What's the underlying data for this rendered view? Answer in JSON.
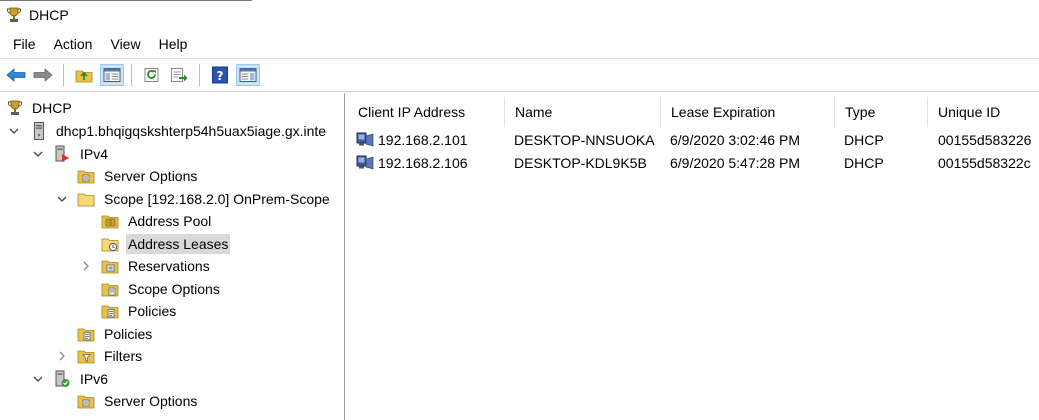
{
  "window": {
    "title": "DHCP"
  },
  "menu": [
    "File",
    "Action",
    "View",
    "Help"
  ],
  "toolbar": {
    "buttons": [
      "back-arrow-icon",
      "forward-arrow-icon",
      "up-folder-icon",
      "show-hide-console-tree-icon",
      "refresh-icon",
      "export-list-icon",
      "help-icon",
      "properties-icon"
    ]
  },
  "tree": {
    "root": "DHCP",
    "server": "dhcp1.bhqigqskshterp54h5uax5iage.gx.inte",
    "ipv4": "IPv4",
    "ipv4_server_options": "Server Options",
    "scope": "Scope [192.168.2.0] OnPrem-Scope",
    "address_pool": "Address Pool",
    "address_leases": "Address Leases",
    "reservations": "Reservations",
    "scope_options": "Scope Options",
    "scope_policies": "Policies",
    "ipv4_policies": "Policies",
    "filters": "Filters",
    "ipv6": "IPv6",
    "ipv6_server_options": "Server Options"
  },
  "leases": {
    "columns": [
      "Client IP Address",
      "Name",
      "Lease Expiration",
      "Type",
      "Unique ID"
    ],
    "rows": [
      [
        "192.168.2.101",
        "DESKTOP-NNSUOKA",
        "6/9/2020 3:02:46 PM",
        "DHCP",
        "00155d583226"
      ],
      [
        "192.168.2.106",
        "DESKTOP-KDL9K5B",
        "6/9/2020 5:47:28 PM",
        "DHCP",
        "00155d58322c"
      ]
    ]
  }
}
